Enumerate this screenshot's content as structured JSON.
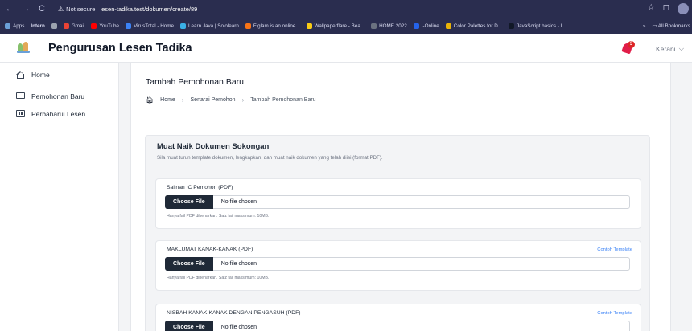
{
  "browser": {
    "nav": [
      "←",
      "→",
      "C"
    ],
    "not_secure": "Not secure",
    "url": "lesen-tadika.test/dokumen/create/89",
    "bookmarks": [
      {
        "label": "Apps",
        "color": "#6aa0d8"
      },
      {
        "label": "Intern",
        "color": "#f59e0b"
      },
      {
        "label": "",
        "color": "#9ca3af"
      },
      {
        "label": "Gmail",
        "color": "#ea4335"
      },
      {
        "label": "YouTube",
        "color": "#ff0000"
      },
      {
        "label": "VirusTotal - Home",
        "color": "#3b82f6"
      },
      {
        "label": "Learn Java | Sololearn",
        "color": "#3ab0e6"
      },
      {
        "label": "Figlam is an online...",
        "color": "#f97316"
      },
      {
        "label": "Wallpaperflare - Bea...",
        "color": "#facc15"
      },
      {
        "label": "HOME 2022",
        "color": "#6b7280"
      },
      {
        "label": "I-Online",
        "color": "#2563eb"
      },
      {
        "label": "Color Palettes for D...",
        "color": "#eab308"
      },
      {
        "label": "JavaScript basics - L...",
        "color": "#111827"
      }
    ],
    "more": "»",
    "all_bookmarks": "All Bookmarks"
  },
  "header": {
    "title": "Pengurusan Lesen Tadika",
    "notification_count": "3",
    "user": "Kerani"
  },
  "sidebar": {
    "items": [
      {
        "label": "Home",
        "icon": "home-icon"
      },
      {
        "label": "Pemohonan Baru",
        "icon": "monitor-icon"
      },
      {
        "label": "Perbaharui Lesen",
        "icon": "id-card-icon"
      }
    ]
  },
  "page": {
    "title": "Tambah Pemohonan Baru",
    "breadcrumb": [
      "Home",
      "Senarai Pemohon",
      "Tambah Pemohonan Baru"
    ]
  },
  "panel": {
    "title": "Muat Naik Dokumen Sokongan",
    "description": "Sila muat turun template dokumen, lengkapkan, dan muat naik dokumen yang telah diisi (format PDF).",
    "uploads": [
      {
        "label": "Salinan IC Pemohon (PDF)",
        "template": "",
        "button": "Choose File",
        "status": "No file chosen",
        "hint": "Hanya fail PDF dibenarkan. Saiz fail maksimum: 10MB."
      },
      {
        "label": "MAKLUMAT KANAK-KANAK (PDF)",
        "template": "Contoh Template",
        "button": "Choose File",
        "status": "No file chosen",
        "hint": "Hanya fail PDF dibenarkan. Saiz fail maksimum: 10MB."
      },
      {
        "label": "NISBAH KANAK-KANAK DENGAN PENGASUH (PDF)",
        "template": "Contoh Template",
        "button": "Choose File",
        "status": "No file chosen",
        "hint": ""
      }
    ]
  }
}
